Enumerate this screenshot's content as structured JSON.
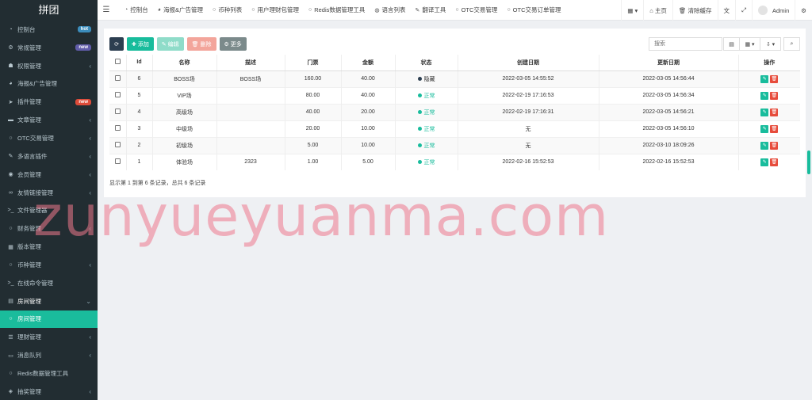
{
  "brand": "拼团",
  "sidebar": {
    "items": [
      {
        "icon": "dashboard-icon",
        "glyph": "◔",
        "label": "控制台",
        "badge": "hot",
        "badge_color": "#3c8dbc"
      },
      {
        "icon": "cog-icon",
        "glyph": "⚙",
        "label": "常规管理",
        "badge": "new",
        "badge_color": "#605ca8"
      },
      {
        "icon": "users-icon",
        "glyph": "☗",
        "label": "权限管理",
        "arrow": "‹"
      },
      {
        "icon": "poster-icon",
        "glyph": "◕",
        "label": "海报&广告管理"
      },
      {
        "icon": "rocket-icon",
        "glyph": "➤",
        "label": "插件管理",
        "badge": "new",
        "badge_color": "#dd4b39"
      },
      {
        "icon": "folder-icon",
        "glyph": "▬",
        "label": "文章管理",
        "arrow": "‹"
      },
      {
        "icon": "circle-icon",
        "glyph": "○",
        "label": "OTC交易管理",
        "arrow": "‹"
      },
      {
        "icon": "language-icon",
        "glyph": "✎",
        "label": "多语言插件",
        "arrow": "‹"
      },
      {
        "icon": "user-circle-icon",
        "glyph": "◉",
        "label": "会员管理",
        "arrow": "‹"
      },
      {
        "icon": "link-icon",
        "glyph": "∞",
        "label": "友情链接管理",
        "arrow": "‹"
      },
      {
        "icon": "terminal-icon",
        "glyph": ">_",
        "label": "文件管理器"
      },
      {
        "icon": "circle-icon",
        "glyph": "○",
        "label": "财务管理",
        "arrow": "‹"
      },
      {
        "icon": "version-icon",
        "glyph": "▦",
        "label": "版本管理"
      },
      {
        "icon": "circle-icon",
        "glyph": "○",
        "label": "币种管理",
        "arrow": "‹"
      },
      {
        "icon": "terminal-icon",
        "glyph": ">_",
        "label": "在线命令管理"
      },
      {
        "icon": "building-icon",
        "glyph": "▤",
        "label": "房间管理",
        "arrow": "⌄",
        "state": "open"
      },
      {
        "icon": "circle-icon",
        "glyph": "○",
        "label": "房间管理",
        "state": "active"
      },
      {
        "icon": "list-icon",
        "glyph": "☰",
        "label": "理财管理",
        "arrow": "‹"
      },
      {
        "icon": "queue-icon",
        "glyph": "▭",
        "label": "消息队列",
        "arrow": "‹"
      },
      {
        "icon": "circle-icon",
        "glyph": "○",
        "label": "Redis数据管理工具"
      },
      {
        "icon": "gift-icon",
        "glyph": "◈",
        "label": "抽奖管理",
        "arrow": "‹"
      }
    ]
  },
  "topbar": {
    "tabs": [
      {
        "icon": "dashboard-icon",
        "glyph": "◔",
        "label": "控制台"
      },
      {
        "icon": "poster-icon",
        "glyph": "◕",
        "label": "海报&广告管理"
      },
      {
        "icon": "circle-icon",
        "glyph": "○",
        "label": "币种列表"
      },
      {
        "icon": "circle-icon",
        "glyph": "○",
        "label": "用户理财包管理"
      },
      {
        "icon": "circle-icon",
        "glyph": "○",
        "label": "Redis数据管理工具"
      },
      {
        "icon": "globe-icon",
        "glyph": "◍",
        "label": "语言列表"
      },
      {
        "icon": "translate-icon",
        "glyph": "✎",
        "label": "翻译工具"
      },
      {
        "icon": "circle-icon",
        "glyph": "○",
        "label": "OTC交易管理"
      },
      {
        "icon": "circle-icon",
        "glyph": "○",
        "label": "OTC交易订单管理"
      }
    ],
    "home_label": "主页",
    "clear_cache_label": "清除缓存",
    "admin_label": "Admin"
  },
  "toolbar": {
    "add_label": "添加",
    "edit_label": "编辑",
    "delete_label": "删除",
    "more_label": "更多"
  },
  "search": {
    "placeholder": "搜索"
  },
  "table": {
    "columns": [
      "",
      "Id",
      "名称",
      "描述",
      "门票",
      "金额",
      "状态",
      "创建日期",
      "更新日期",
      "操作"
    ],
    "rows": [
      {
        "id": "6",
        "name": "BOSS场",
        "desc": "BOSS场",
        "ticket": "160.00",
        "amount": "40.00",
        "status": "隐藏",
        "status_color": "#2c3e50",
        "created": "2022-03-05 14:55:52",
        "updated": "2022-03-05 14:56:44"
      },
      {
        "id": "5",
        "name": "VIP场",
        "desc": "",
        "ticket": "80.00",
        "amount": "40.00",
        "status": "正常",
        "status_color": "#18bc9c",
        "created": "2022-02-19 17:16:53",
        "updated": "2022-03-05 14:56:34"
      },
      {
        "id": "4",
        "name": "高级场",
        "desc": "",
        "ticket": "40.00",
        "amount": "20.00",
        "status": "正常",
        "status_color": "#18bc9c",
        "created": "2022-02-19 17:16:31",
        "updated": "2022-03-05 14:56:21"
      },
      {
        "id": "3",
        "name": "中级场",
        "desc": "",
        "ticket": "20.00",
        "amount": "10.00",
        "status": "正常",
        "status_color": "#18bc9c",
        "created": "无",
        "updated": "2022-03-05 14:56:10"
      },
      {
        "id": "2",
        "name": "初级场",
        "desc": "",
        "ticket": "5.00",
        "amount": "10.00",
        "status": "正常",
        "status_color": "#18bc9c",
        "created": "无",
        "updated": "2022-03-10 18:09:26"
      },
      {
        "id": "1",
        "name": "体验场",
        "desc": "2323",
        "ticket": "1.00",
        "amount": "5.00",
        "status": "正常",
        "status_color": "#18bc9c",
        "created": "2022-02-16 15:52:53",
        "updated": "2022-02-16 15:52:53"
      }
    ]
  },
  "footer": "显示第 1 到第 6 条记录，总共 6 条记录",
  "watermark": "zunyueyuanma.com"
}
